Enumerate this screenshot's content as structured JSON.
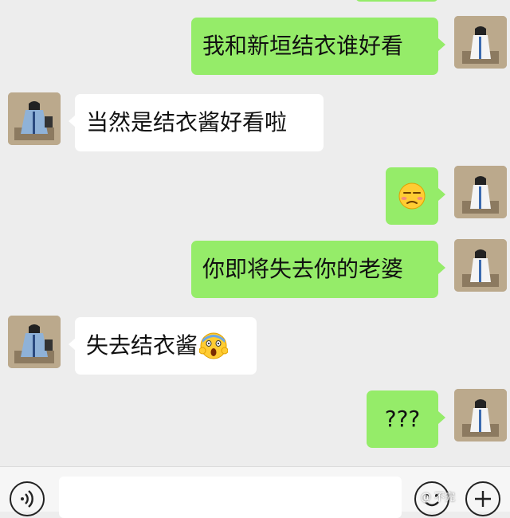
{
  "messages": [
    {
      "side": "me",
      "text": "我和新垣结衣谁好看"
    },
    {
      "side": "them",
      "text": "当然是结衣酱好看啦"
    },
    {
      "side": "me",
      "emoji": "unamused-face"
    },
    {
      "side": "me",
      "text": "你即将失去你的老婆"
    },
    {
      "side": "them",
      "text": "失去结衣酱",
      "emoji": "screaming-face"
    },
    {
      "side": "me",
      "text": "???"
    }
  ],
  "input_bar": {
    "voice_icon": "voice-icon",
    "emoji_icon": "emoji-icon",
    "plus_icon": "plus-icon"
  },
  "watermark": "@ 不完",
  "colors": {
    "my_bubble": "#95ec69",
    "their_bubble": "#ffffff",
    "background": "#ededed"
  }
}
